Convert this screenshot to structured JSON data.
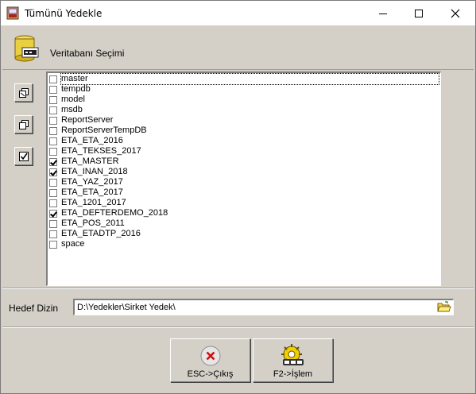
{
  "window": {
    "title": "Tümünü Yedekle"
  },
  "header": {
    "label": "Veritabanı Seçimi",
    "icon": "database-icon"
  },
  "tools": [
    {
      "icon": "select-all-icon"
    },
    {
      "icon": "deselect-all-icon"
    },
    {
      "icon": "check-icon"
    }
  ],
  "databases": [
    {
      "name": "master",
      "checked": false
    },
    {
      "name": "tempdb",
      "checked": false
    },
    {
      "name": "model",
      "checked": false
    },
    {
      "name": "msdb",
      "checked": false
    },
    {
      "name": "ReportServer",
      "checked": false
    },
    {
      "name": "ReportServerTempDB",
      "checked": false
    },
    {
      "name": "ETA_ETA_2016",
      "checked": false
    },
    {
      "name": "ETA_TEKSES_2017",
      "checked": false
    },
    {
      "name": "ETA_MASTER",
      "checked": true
    },
    {
      "name": "ETA_INAN_2018",
      "checked": true
    },
    {
      "name": "ETA_YAZ_2017",
      "checked": false
    },
    {
      "name": "ETA_ETA_2017",
      "checked": false
    },
    {
      "name": "ETA_1201_2017",
      "checked": false
    },
    {
      "name": "ETA_DEFTERDEMO_2018",
      "checked": true
    },
    {
      "name": "ETA_POS_2011",
      "checked": false
    },
    {
      "name": "ETA_ETADTP_2016",
      "checked": false
    },
    {
      "name": "space",
      "checked": false
    }
  ],
  "target": {
    "label": "Hedef Dizin",
    "value": "D:\\Yedekler\\Sirket Yedek\\"
  },
  "buttons": {
    "esc_label": "ESC->Çıkış",
    "f2_label": "F2->İşlem"
  }
}
